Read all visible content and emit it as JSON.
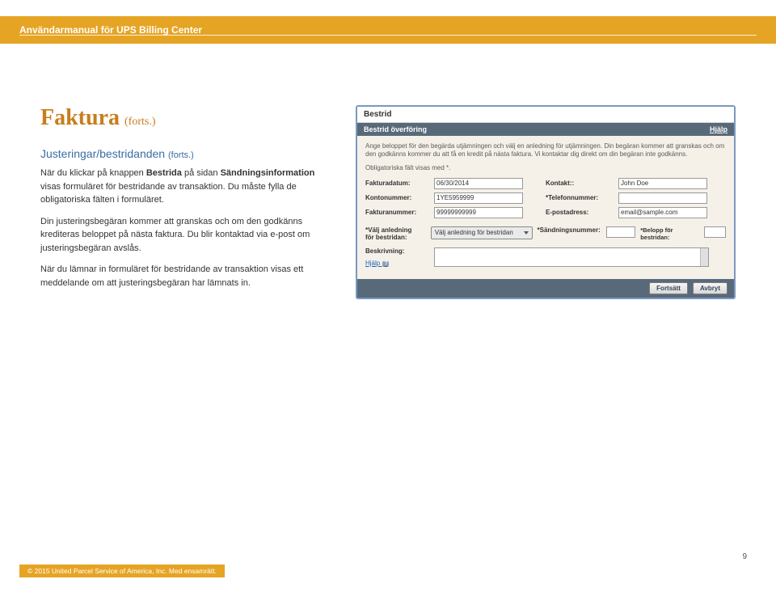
{
  "header": {
    "title": "Användarmanual för UPS Billing Center"
  },
  "heading": {
    "main": "Faktura",
    "suffix": "(forts.)"
  },
  "subhead": {
    "main": "Justeringar/bestridanden",
    "suffix": "(forts.)"
  },
  "body": {
    "p1_pre": "När du klickar på knappen ",
    "p1_bold": "Bestrida",
    "p1_mid": " på sidan ",
    "p1_bold2": "Sändningsinformation",
    "p1_post": " visas formuläret för bestridande av transaktion. Du måste fylla de obligatoriska fälten i formuläret.",
    "p2": "Din justeringsbegäran kommer att granskas och om den godkänns krediteras beloppet på nästa faktura. Du blir kontaktad via e-post om justeringsbegäran avslås.",
    "p3": "När du lämnar in formuläret för bestridande av transaktion visas ett meddelande om att justeringsbegäran har lämnats in."
  },
  "mock": {
    "title": "Bestrid",
    "bar_label": "Bestrid överföring",
    "bar_help": "Hjälp",
    "desc": "Ange beloppet för den begärda utjämningen och välj en anledning för utjämningen. Din begäran kommer att granskas och om den godkänns kommer du att få en kredit på nästa faktura. Vi kontaktar dig direkt om din begäran inte godkänns.",
    "note": "Obligatoriska fält visas med *.",
    "labels": {
      "fakturadatum": "Fakturadatum:",
      "kontonummer": "Kontonummer:",
      "fakturanummer": "Fakturanummer:",
      "kontakt": "Kontakt::",
      "telefonnummer": "*Telefonnummer:",
      "epostadress": "E-postadress:",
      "valj_anledning_1": "*Välj anledning",
      "valj_anledning_2": "för bestridan:",
      "sandningsnummer": "*Sändningsnummer:",
      "belopp": "*Belopp för bestridan:",
      "beskrivning": "Beskrivning:",
      "hjalp": "Hjälp"
    },
    "values": {
      "fakturadatum": "06/30/2014",
      "kontonummer": "1YE5959999",
      "fakturanummer": "99999999999",
      "kontakt": "John Doe",
      "telefonnummer": "",
      "epostadress": "email@sample.com",
      "select": "Välj anledning för bestridan",
      "sandningsnummer": "",
      "belopp": "",
      "hjalp_icon": "?"
    },
    "buttons": {
      "fortsatt": "Fortsätt",
      "avbryt": "Avbryt"
    }
  },
  "page_number": "9",
  "copyright": "© 2015 United Parcel Service of America, Inc. Med ensamrätt."
}
